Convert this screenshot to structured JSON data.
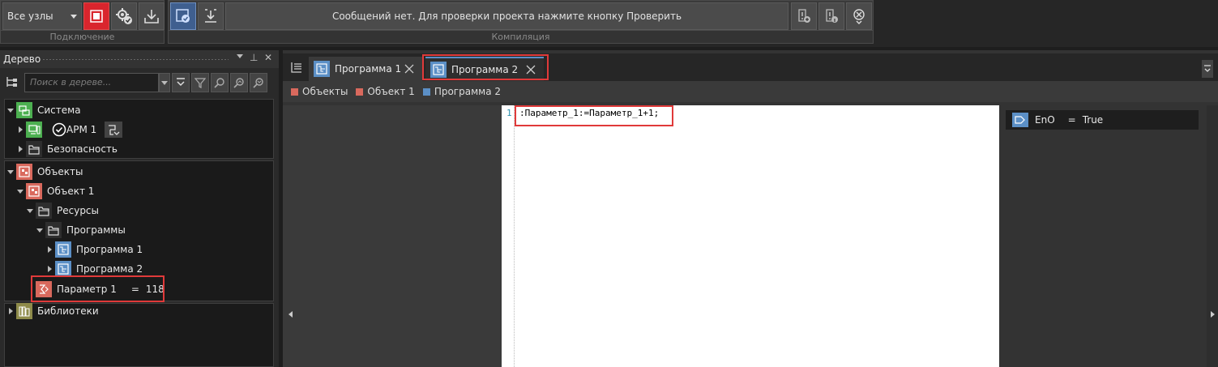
{
  "toolbar": {
    "node_select": "Все узлы",
    "message": "Сообщений нет. Для проверки проекта нажмите кнопку Проверить",
    "group_connection": "Подключение",
    "group_compile": "Компиляция"
  },
  "tree": {
    "title": "Дерево",
    "search_placeholder": "Поиск в дереве...",
    "items": {
      "system": "Система",
      "arm": "АРМ 1",
      "security": "Безопасность",
      "objects": "Объекты",
      "object1": "Объект 1",
      "resources": "Ресурсы",
      "programs": "Программы",
      "program1": "Программа 1",
      "program2": "Программа 2",
      "param1": "Параметр 1",
      "param1_eq": "=",
      "param1_value": "118",
      "libraries": "Библиотеки"
    }
  },
  "tabs": [
    {
      "label": "Программа 1"
    },
    {
      "label": "Программа 2"
    }
  ],
  "breadcrumbs": [
    {
      "label": "Объекты",
      "color": "#d9695d"
    },
    {
      "label": "Объект 1",
      "color": "#d9695d"
    },
    {
      "label": "Программа 2",
      "color": "#5b8fc6"
    }
  ],
  "editor": {
    "line_number": "1",
    "code": ":Параметр_1:=Параметр_1+1;"
  },
  "variables": {
    "name": "EnO",
    "eq": "=",
    "value": "True"
  },
  "colors": {
    "system_green": "#4caf50",
    "object_red": "#d9695d",
    "program_blue": "#5b8fc6",
    "library_olive": "#8e8b4a",
    "stop_red": "#d9252d",
    "highlight": "#e03a3a"
  }
}
